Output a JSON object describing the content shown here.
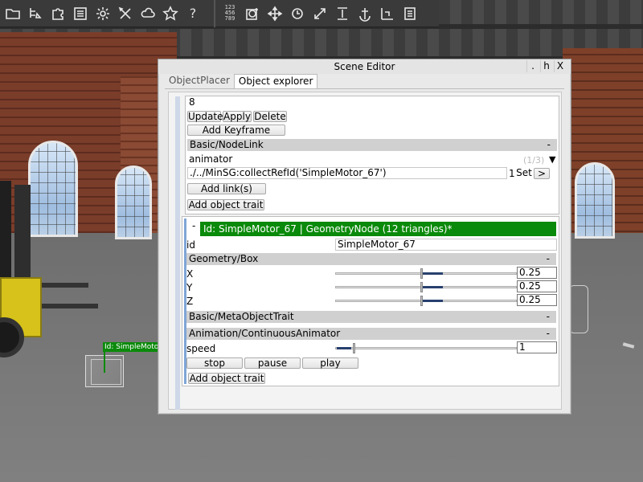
{
  "toolbar": {
    "group1": [
      "folder-icon",
      "tree-nodes-icon",
      "puzzle-icon",
      "list-icon",
      "gear-icon",
      "tools-icon",
      "cloud-icon",
      "star-icon",
      "help-icon"
    ],
    "help_label": "?",
    "digits": "123\n456\n789",
    "group2": [
      "grid-digits-icon",
      "snap-icon",
      "move-icon",
      "rotate-icon",
      "scale-icon",
      "align-icon",
      "anchor-icon",
      "measure-icon",
      "notes-icon"
    ]
  },
  "scene": {
    "object_label": "Id: SimpleMotor..."
  },
  "window": {
    "title": "Scene Editor",
    "buttons": [
      ".",
      "h",
      "X"
    ],
    "tabs": [
      {
        "label": "ObjectPlacer",
        "active": false
      },
      {
        "label": "Object explorer",
        "active": true
      }
    ]
  },
  "keyframe_panel": {
    "value": "8",
    "update_label": "Update",
    "apply_label": "Apply",
    "delete_label": "Delete",
    "add_keyframe_label": "Add Keyframe",
    "nodelink_section": "Basic/NodeLink",
    "section_toggle": "-",
    "link_type": "animator",
    "link_counter": "(1/3)",
    "link_path": "./../MinSG:collectRefId('SimpleMotor_67')",
    "link_index": "1",
    "set_label": "Set",
    "goto_label": ">",
    "add_links_label": "Add link(s)",
    "add_trait_label": "Add object trait"
  },
  "node_panel": {
    "collapse": "-",
    "header": "Id: SimpleMotor_67 | GeometryNode (12 triangles)*",
    "id_label": "id",
    "id_value": "SimpleMotor_67",
    "geometry_section": "Geometry/Box",
    "x_label": "X",
    "x_value": "0.25",
    "y_label": "Y",
    "y_value": "0.25",
    "z_label": "Z",
    "z_value": "0.25",
    "meta_section": "Basic/MetaObjectTrait",
    "animator_section": "Animation/ContinuousAnimator",
    "speed_label": "speed",
    "speed_value": "1",
    "stop_label": "stop",
    "pause_label": "pause",
    "play_label": "play",
    "add_trait_label": "Add object trait"
  },
  "colors": {
    "node_header": "#0a8a0a",
    "slider_fill": "#27406e",
    "window_bg": "#e9e9e9"
  }
}
